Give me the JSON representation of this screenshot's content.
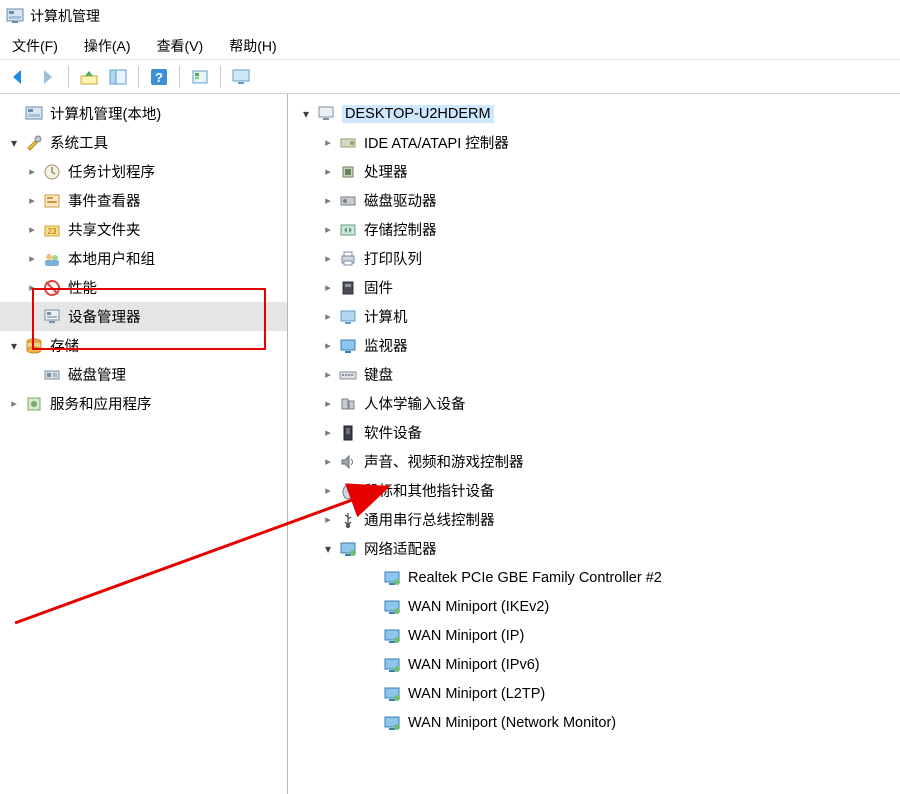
{
  "title": "计算机管理",
  "menu": {
    "file": "文件(F)",
    "action": "操作(A)",
    "view": "查看(V)",
    "help": "帮助(H)"
  },
  "left_tree": {
    "root": "计算机管理(本地)",
    "system_tools": "系统工具",
    "task_scheduler": "任务计划程序",
    "event_viewer": "事件查看器",
    "shared_folders": "共享文件夹",
    "local_users": "本地用户和组",
    "performance": "性能",
    "device_manager": "设备管理器",
    "storage": "存储",
    "disk_management": "磁盘管理",
    "services_apps": "服务和应用程序"
  },
  "right_tree": {
    "root": "DESKTOP-U2HDERM",
    "ide": "IDE ATA/ATAPI 控制器",
    "processor": "处理器",
    "disk_drives": "磁盘驱动器",
    "storage_ctrl": "存储控制器",
    "print_queue": "打印队列",
    "firmware": "固件",
    "computer": "计算机",
    "monitor": "监视器",
    "keyboard": "键盘",
    "hid": "人体学输入设备",
    "software_dev": "软件设备",
    "sound": "声音、视频和游戏控制器",
    "mouse": "鼠标和其他指针设备",
    "usb": "通用串行总线控制器",
    "network": "网络适配器",
    "adapters": [
      "Realtek PCIe GBE Family Controller #2",
      "WAN Miniport (IKEv2)",
      "WAN Miniport (IP)",
      "WAN Miniport (IPv6)",
      "WAN Miniport (L2TP)",
      "WAN Miniport (Network Monitor)"
    ]
  }
}
